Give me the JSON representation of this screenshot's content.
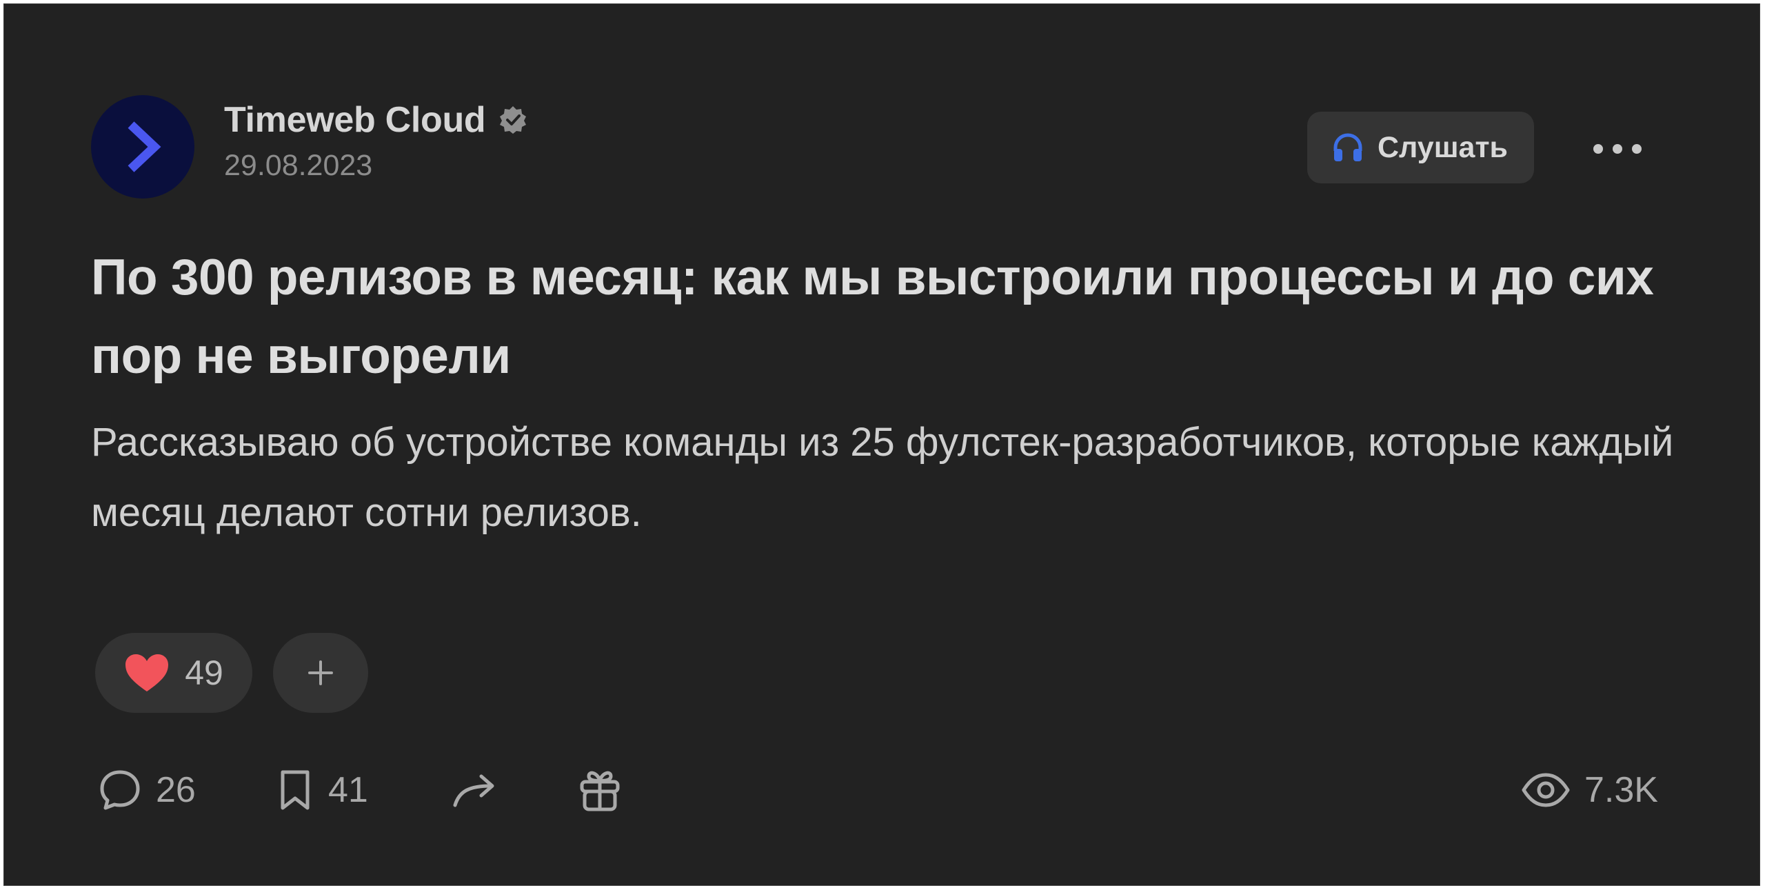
{
  "post": {
    "author": "Timeweb Cloud",
    "date": "29.08.2023",
    "listen_label": "Слушать",
    "title": "По 300 релизов в месяц: как мы выстроили процессы и до сих пор не выгорели",
    "lead": "Рассказываю об устройстве команды из 25 фулстек-разработчиков, которые каждый месяц делают сотни релизов."
  },
  "reactions": {
    "likes": "49"
  },
  "stats": {
    "comments": "26",
    "bookmarks": "41",
    "views": "7.3K"
  },
  "icons": {
    "avatar": "timeweb-chevron-logo",
    "verified": "verified-badge-icon",
    "listen": "headphones-icon",
    "more": "more-dots-icon",
    "like": "heart-icon",
    "add": "plus-icon",
    "comments": "comment-icon",
    "bookmark": "bookmark-icon",
    "share": "share-arrow-icon",
    "gift": "gift-icon",
    "views": "eye-icon"
  },
  "colors": {
    "background": "#222222",
    "accent_blue": "#3d6fe6",
    "logo_blue": "#4a57f0",
    "heart": "#f2545b"
  }
}
